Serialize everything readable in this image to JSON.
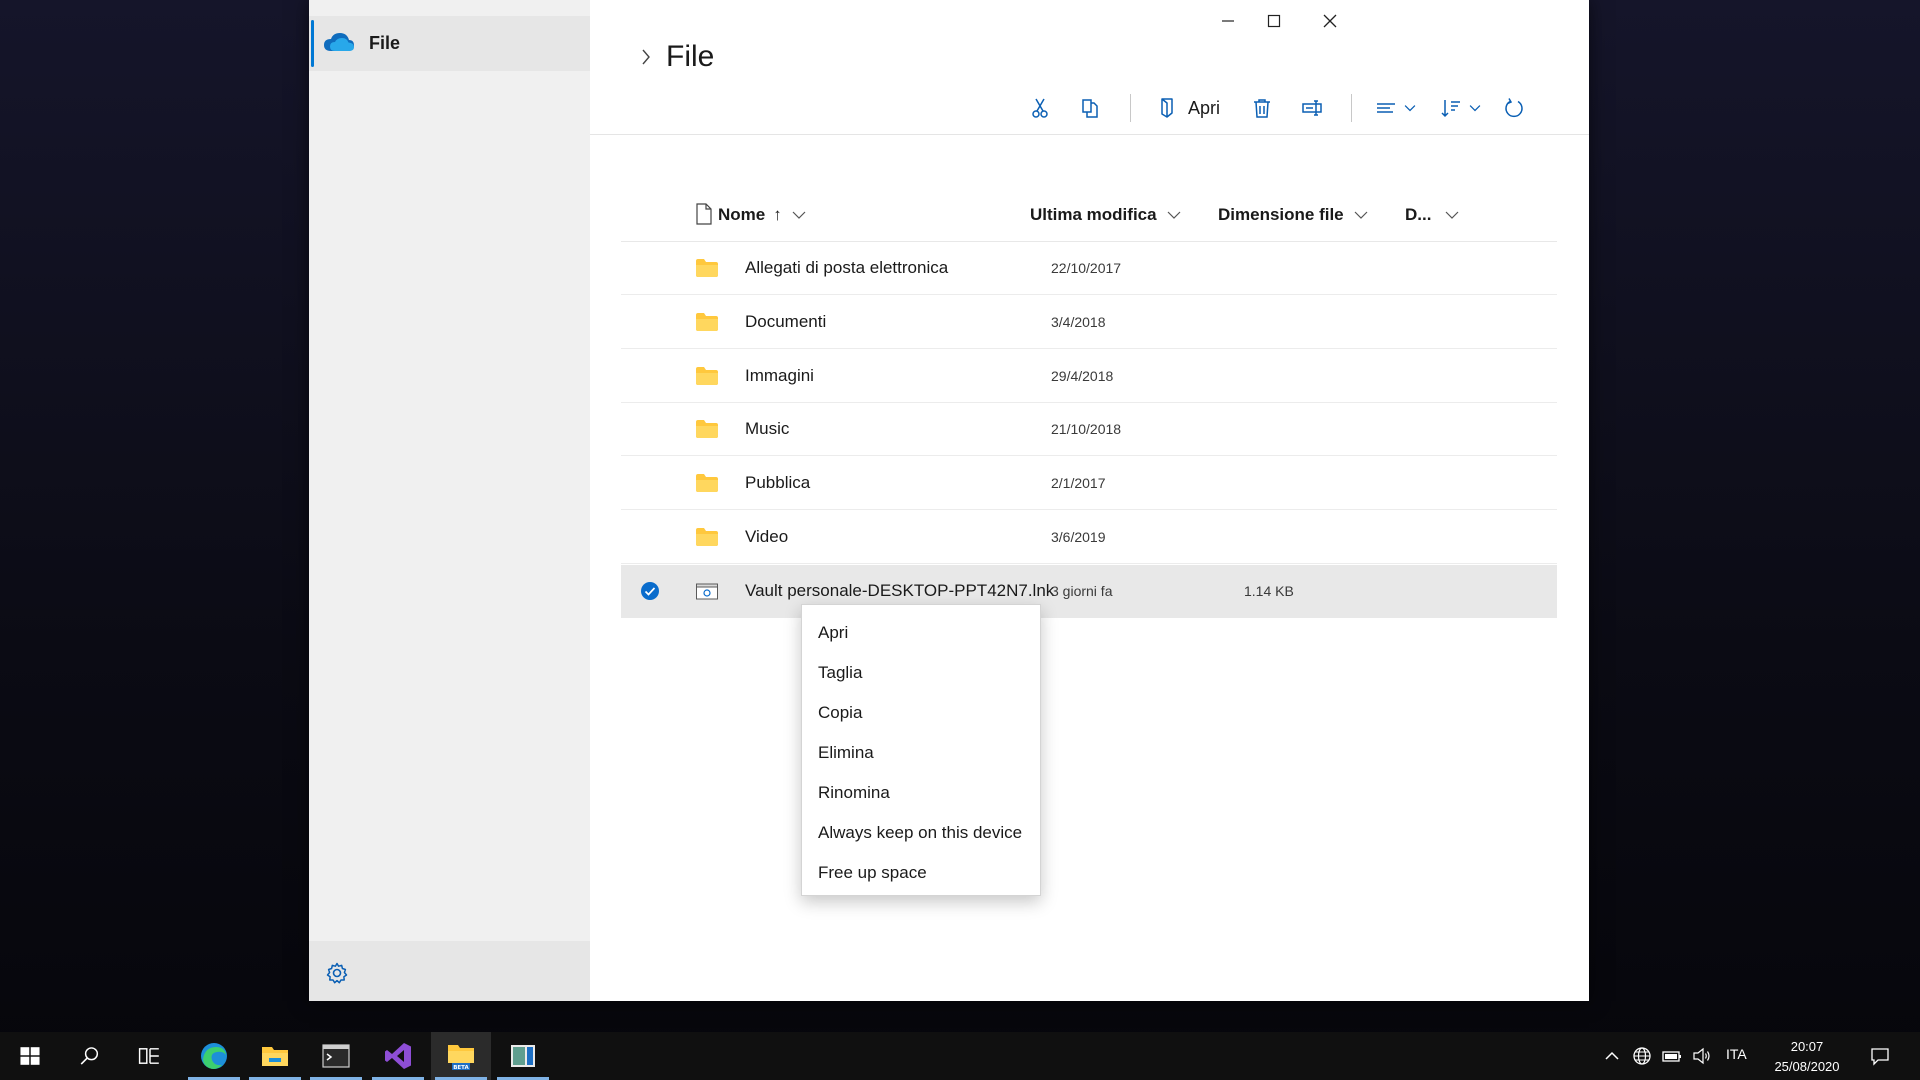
{
  "sidebar": {
    "items": [
      {
        "label": "File",
        "icon": "onedrive-cloud-icon"
      }
    ],
    "settings_icon": "gear-icon"
  },
  "window_controls": [
    "minimize",
    "maximize",
    "close"
  ],
  "header": {
    "title": "File"
  },
  "toolbar": {
    "open_label": "Apri"
  },
  "table": {
    "columns": {
      "name": "Nome",
      "modified": "Ultima modifica",
      "size": "Dimensione file",
      "extra": "D..."
    },
    "rows": [
      {
        "name": "Allegati di posta elettronica",
        "modified": "22/10/2017",
        "size": "",
        "type": "folder"
      },
      {
        "name": "Documenti",
        "modified": "3/4/2018",
        "size": "",
        "type": "folder"
      },
      {
        "name": "Immagini",
        "modified": "29/4/2018",
        "size": "",
        "type": "folder"
      },
      {
        "name": "Music",
        "modified": "21/10/2018",
        "size": "",
        "type": "folder"
      },
      {
        "name": "Pubblica",
        "modified": "2/1/2017",
        "size": "",
        "type": "folder"
      },
      {
        "name": "Video",
        "modified": "3/6/2019",
        "size": "",
        "type": "folder"
      },
      {
        "name": "Vault personale-DESKTOP-PPT42N7.lnk",
        "modified": "3 giorni fa",
        "size": "1.14 KB",
        "type": "shortcut",
        "selected": true
      }
    ]
  },
  "context_menu": {
    "items": [
      "Apri",
      "Taglia",
      "Copia",
      "Elimina",
      "Rinomina",
      "Always keep on this device",
      "Free up space"
    ]
  },
  "taskbar": {
    "language": "ITA",
    "time": "20:07",
    "date": "25/08/2020",
    "beta_label": "BETA"
  },
  "colors": {
    "accent": "#0078d4",
    "folder": "#ffc83d",
    "taskbar": "#101010"
  }
}
